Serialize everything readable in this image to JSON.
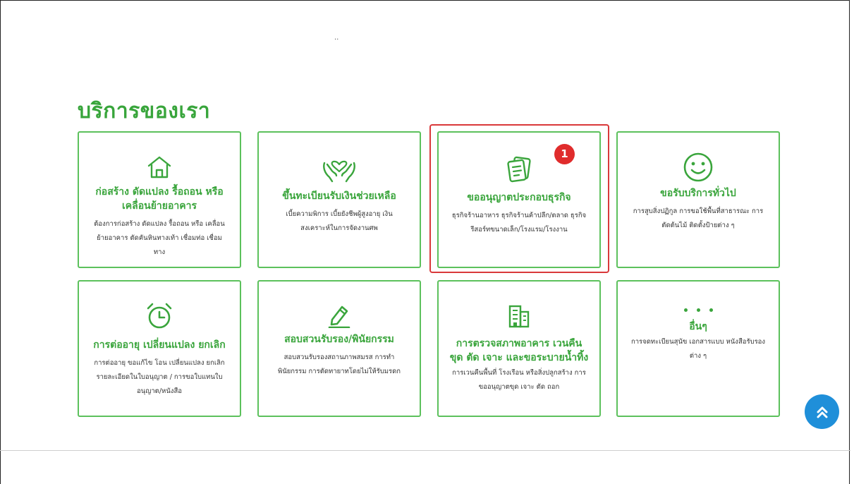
{
  "page": {
    "mark": "..",
    "section_title": "บริการของเรา"
  },
  "services": [
    {
      "title": "ก่อสร้าง ดัดแปลง รื้อถอน หรือเคลื่อนย้ายอาคาร",
      "desc": "ต้องการก่อสร้าง ดัดแปลง รื้อถอน หรือ เคลื่อนย้ายอาคาร ตัดคันหินทางเท้า เชื่อมท่อ เชื่อมทาง",
      "icon": "house-icon"
    },
    {
      "title": "ขึ้นทะเบียนรับเงินช่วยเหลือ",
      "desc": "เบี้ยความพิการ เบี้ยยังชีพผู้สูงอายุ เงินสงเคราะห์ในการจัดงานศพ",
      "icon": "caring-hands-icon"
    },
    {
      "title": "ขออนุญาตประกอบธุรกิจ",
      "desc": "ธุรกิจร้านอาหาร ธุรกิจร้านค้าปลีก/ตลาด ธุรกิจรีสอร์ทขนาดเล็ก/โรงแรม/โรงงาน",
      "icon": "documents-icon"
    },
    {
      "title": "ขอรับบริการทั่วไป",
      "desc": "การสูบสิ่งปฏิกูล การขอใช้พื้นที่สาธารณะ การตัดต้นไม้ ติดตั้งป้ายต่าง ๆ",
      "icon": "smiley-icon"
    },
    {
      "title": "การต่ออายุ เปลี่ยนแปลง ยกเลิก",
      "desc": "การต่ออายุ ขอแก้ไข โอน เปลี่ยนแปลง ยกเลิก รายละเอียดในใบอนุญาต / การขอใบแทนใบอนุญาต/หนังสือ",
      "icon": "alarm-clock-icon"
    },
    {
      "title": "สอบสวนรับรอง/พินัยกรรม",
      "desc": "สอบสวนรับรองสถานภาพสมรส การทำพินัยกรรม การตัดทายาทโดยไม่ให้รับมรดก",
      "icon": "pencil-icon"
    },
    {
      "title": "การตรวจสภาพอาคาร เวนคืน ขุด ตัด เจาะ และขอระบายน้ำทิ้ง",
      "desc": "การเวนคืนพื้นที่ โรงเรือน หรือสิ่งปลูกสร้าง การขออนุญาตขุด เจาะ ตัด ถอก",
      "icon": "building-icon"
    },
    {
      "title": "อื่นๆ",
      "desc": "การจดทะเบียนสุนัข เอกสารแบบ หนังสือรับรองต่าง ๆ",
      "icon": "more-dots-icon"
    }
  ],
  "badge": {
    "value": "1"
  },
  "colors": {
    "accent_green": "#3aa53c",
    "highlight_red": "#d9383a",
    "scroll_blue": "#1f8fd9"
  },
  "scroll_top": {
    "icon": "double-chevron-up-icon"
  }
}
